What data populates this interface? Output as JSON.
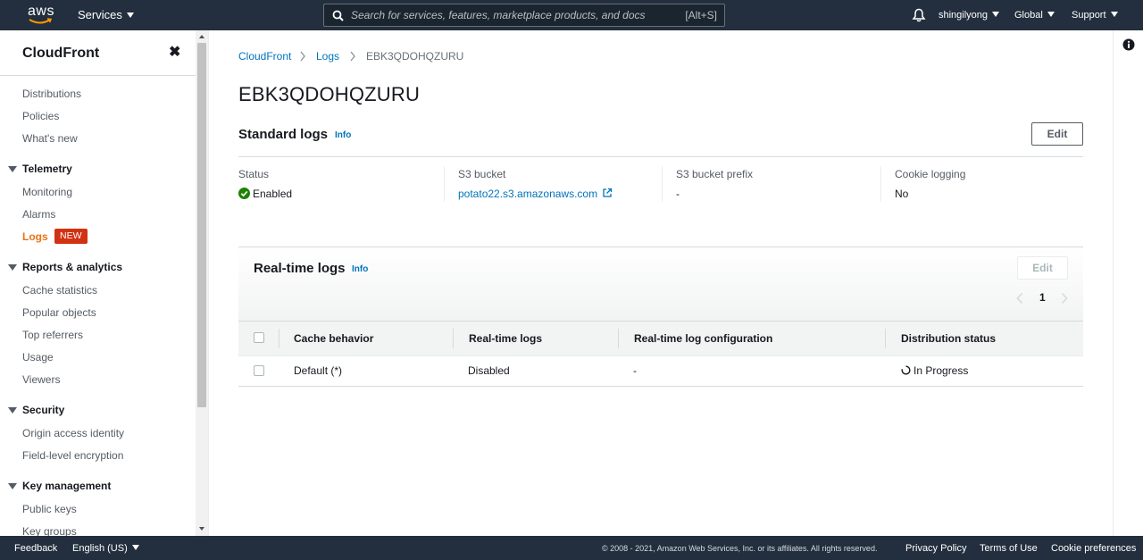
{
  "topnav": {
    "logo_text": "aws",
    "services_label": "Services",
    "search_placeholder": "Search for services, features, marketplace products, and docs",
    "search_shortcut": "[Alt+S]",
    "user": "shingilyong",
    "region": "Global",
    "support": "Support",
    "icons": {
      "search": "search-icon",
      "bell": "bell-icon",
      "caret": "caret-down-icon"
    }
  },
  "sidebar": {
    "title": "CloudFront",
    "close_glyph": "✖",
    "links": {
      "distributions": "Distributions",
      "policies": "Policies",
      "whats_new": "What's new"
    },
    "sections": {
      "telemetry": {
        "title": "Telemetry",
        "items": [
          "Monitoring",
          "Alarms",
          "Logs"
        ]
      },
      "reports": {
        "title": "Reports & analytics",
        "items": [
          "Cache statistics",
          "Popular objects",
          "Top referrers",
          "Usage",
          "Viewers"
        ]
      },
      "security": {
        "title": "Security",
        "items": [
          "Origin access identity",
          "Field-level encryption"
        ]
      },
      "key_management": {
        "title": "Key management",
        "items": [
          "Public keys",
          "Key groups"
        ]
      }
    },
    "new_badge": "NEW",
    "active_item": "Logs",
    "active_color": "#ec7211",
    "badge_color": "#d13212"
  },
  "breadcrumb": [
    "CloudFront",
    "Logs",
    "EBK3QDOHQZURU"
  ],
  "page_title": "EBK3QDOHQZURU",
  "standard_logs": {
    "title": "Standard logs",
    "info": "Info",
    "edit_label": "Edit",
    "fields": {
      "status_label": "Status",
      "status_value": "Enabled",
      "bucket_label": "S3 bucket",
      "bucket_value": "potato22.s3.amazonaws.com",
      "prefix_label": "S3 bucket prefix",
      "prefix_value": "-",
      "cookie_label": "Cookie logging",
      "cookie_value": "No"
    }
  },
  "realtime_logs": {
    "title": "Real-time logs",
    "info": "Info",
    "edit_label": "Edit",
    "page": "1",
    "columns": [
      "Cache behavior",
      "Real-time logs",
      "Real-time log configuration",
      "Distribution status"
    ],
    "rows": [
      {
        "cache_behavior": "Default (*)",
        "realtime_logs": "Disabled",
        "config": "-",
        "status": "In Progress"
      }
    ]
  },
  "footer": {
    "feedback": "Feedback",
    "language": "English (US)",
    "copyright": "© 2008 - 2021, Amazon Web Services, Inc. or its affiliates. All rights reserved.",
    "privacy": "Privacy Policy",
    "terms": "Terms of Use",
    "cookies": "Cookie preferences"
  },
  "colors": {
    "nav_bg": "#232f3e",
    "link": "#0073bb",
    "success": "#1d8102"
  }
}
